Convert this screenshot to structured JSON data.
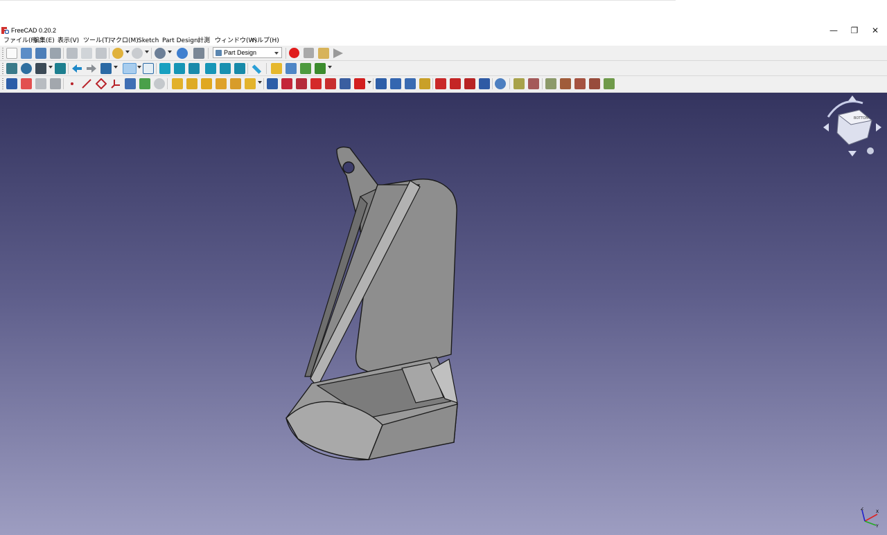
{
  "window": {
    "title": "FreeCAD 0.20.2",
    "controls": {
      "minimize": "—",
      "restore": "❐",
      "close": "✕"
    }
  },
  "menu": {
    "items": [
      "ファイル(F)",
      "編集(E)",
      "表示(V)",
      "ツール(T)",
      "マクロ(M)",
      "Sketch",
      "Part Design",
      "計測",
      "ウィンドウ(W)",
      "ヘルプ(H)"
    ]
  },
  "toolbar1": {
    "workbench": "Part Design",
    "icons": [
      "new-document-icon",
      "open-icon",
      "save-icon",
      "print-icon",
      "cut-icon",
      "copy-icon",
      "paste-icon",
      "undo-icon",
      "redo-icon",
      "refresh-icon",
      "whats-this-icon",
      "macro-record-icon",
      "macro-stop-icon",
      "macro-edit-icon",
      "macro-run-icon"
    ]
  },
  "toolbar2": {
    "icons": [
      "fit-all-icon",
      "fit-selection-icon",
      "draw-style-icon",
      "sync-view-icon",
      "back-icon",
      "forward-icon",
      "std-views-icon",
      "zoom-icon",
      "isometric-icon",
      "front-icon",
      "top-icon",
      "right-icon",
      "rear-icon",
      "bottom-icon",
      "left-icon",
      "measure-icon",
      "part-icon",
      "group-icon",
      "link-icon",
      "link-actions-icon"
    ]
  },
  "toolbar3": {
    "icons": [
      "body-icon",
      "sketch-icon",
      "validate-sketch-icon",
      "clone-icon",
      "datum-point-icon",
      "datum-line-icon",
      "datum-plane-icon",
      "local-cs-icon",
      "shape-binder-icon",
      "subshape-binder-icon",
      "clone-icon",
      "pad-icon",
      "revolution-icon",
      "additive-loft-icon",
      "additive-pipe-icon",
      "additive-helix-icon",
      "additive-primitive-icon",
      "pocket-icon",
      "hole-icon",
      "groove-icon",
      "subtractive-loft-icon",
      "subtractive-pipe-icon",
      "subtractive-helix-icon",
      "subtractive-primitive-icon",
      "mirrored-icon",
      "linear-pattern-icon",
      "polar-pattern-icon",
      "multitransform-icon",
      "fillet-icon",
      "chamfer-icon",
      "draft-icon",
      "thickness-icon",
      "boolean-icon",
      "sprocket-icon",
      "involute-gear-icon",
      "shaft-wizard-icon",
      "shaft-design-icon",
      "shaft-design-icon-2",
      "shaft-design-icon-3",
      "shaft-design-icon-4"
    ]
  },
  "navcube": {
    "face_label": "BOTTOM"
  },
  "axis": {
    "x": "X",
    "y": "Y",
    "z": "Z"
  },
  "colors": {
    "accent": "#1e88e5",
    "record": "#e01c1c",
    "model": "#8c8c8c"
  }
}
